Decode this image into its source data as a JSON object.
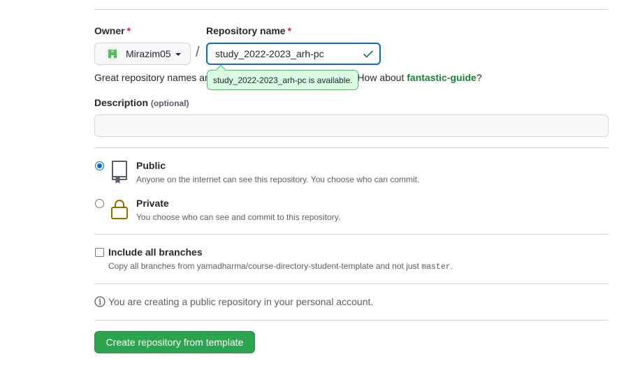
{
  "form": {
    "owner_label": "Owner",
    "required_mark": "*",
    "owner_value": "Mirazim05",
    "separator": "/",
    "repo_label": "Repository name",
    "repo_value": "study_2022-2023_arh-pc",
    "availability_tooltip": "study_2022-2023_arh-pc is available.",
    "hint_prefix": "Great repository names ar",
    "hint_middle": "iration? How about ",
    "hint_suggestion": "fantastic-guide",
    "hint_suffix": "?",
    "description_label": "Description",
    "description_optional": "(optional)",
    "description_value": ""
  },
  "visibility": {
    "public": {
      "title": "Public",
      "description": "Anyone on the internet can see this repository. You choose who can commit.",
      "selected": true,
      "icon": "repo-icon"
    },
    "private": {
      "title": "Private",
      "description": "You choose who can see and commit to this repository.",
      "selected": false,
      "icon": "lock-icon"
    }
  },
  "branches": {
    "title": "Include all branches",
    "description_prefix": "Copy all branches from yamadharma/course-directory-student-template and not just ",
    "branch_name": "master",
    "description_suffix": ".",
    "checked": false
  },
  "info_text": "You are creating a public repository in your personal account.",
  "submit_label": "Create repository from template",
  "colors": {
    "accent": "#0969da",
    "success": "#2da44e",
    "required": "#cf222e",
    "lock": "#9a6700"
  }
}
